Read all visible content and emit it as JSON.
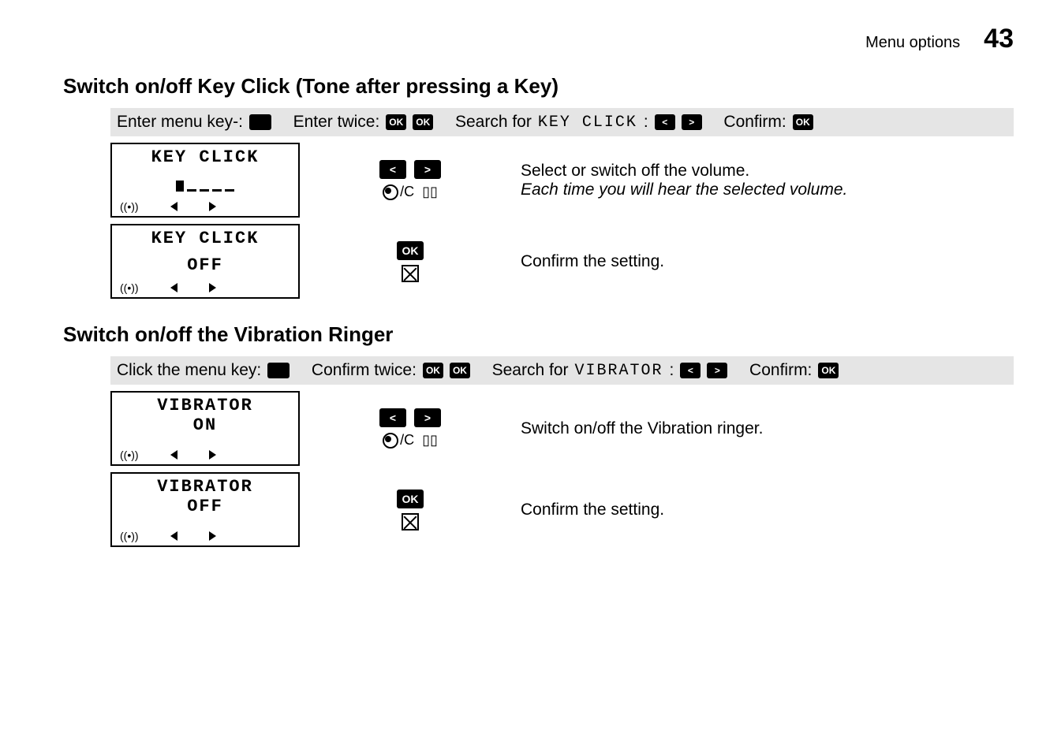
{
  "header": {
    "label": "Menu options",
    "page": "43"
  },
  "section1": {
    "title": "Switch on/off Key Click (Tone after pressing a Key)",
    "bar": {
      "p1": "Enter menu key-:",
      "p2": "Enter twice:",
      "p3a": "Search for",
      "p3b": "KEY CLICK",
      "p3c": ":",
      "p4": "Confirm:"
    },
    "row1": {
      "lcd_title": "KEY CLICK",
      "desc1": "Select or switch off the volume.",
      "desc2": "Each time you will hear the selected volume.",
      "c_label": "/C"
    },
    "row2": {
      "lcd_title": "KEY CLICK",
      "lcd_value": "OFF",
      "desc": "Confirm the setting.",
      "ok": "OK"
    }
  },
  "section2": {
    "title": "Switch on/off the Vibration Ringer",
    "bar": {
      "p1": "Click the menu key:",
      "p2": "Confirm twice:",
      "p3a": "Search for",
      "p3b": "VIBRATOR",
      "p3c": ":",
      "p4": "Confirm:"
    },
    "row1": {
      "lcd_title": "VIBRATOR",
      "lcd_value": "ON",
      "desc": "Switch on/off the Vibration ringer.",
      "c_label": "/C"
    },
    "row2": {
      "lcd_title": "VIBRATOR",
      "lcd_value": "OFF",
      "desc": "Confirm the setting.",
      "ok": "OK"
    }
  },
  "icons": {
    "ok_small": "OK"
  }
}
